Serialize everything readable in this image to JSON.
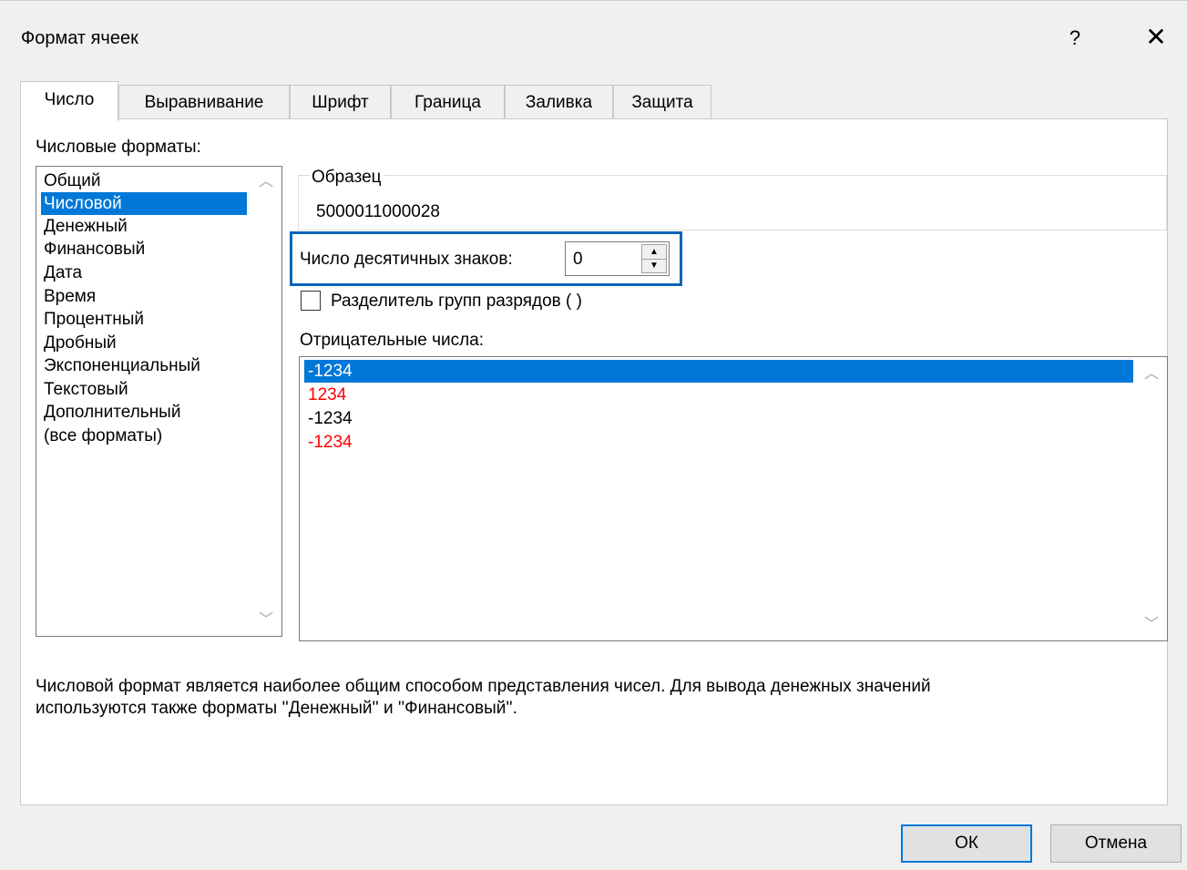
{
  "window": {
    "title": "Формат ячеек",
    "help_label": "?",
    "close_label": "✕"
  },
  "tabs": [
    {
      "label": "Число",
      "active": true
    },
    {
      "label": "Выравнивание",
      "active": false
    },
    {
      "label": "Шрифт",
      "active": false
    },
    {
      "label": "Граница",
      "active": false
    },
    {
      "label": "Заливка",
      "active": false
    },
    {
      "label": "Защита",
      "active": false
    }
  ],
  "categories": {
    "label": "Числовые форматы:",
    "items": [
      "Общий",
      "Числовой",
      "Денежный",
      "Финансовый",
      "Дата",
      "Время",
      "Процентный",
      "Дробный",
      "Экспоненциальный",
      "Текстовый",
      "Дополнительный",
      "(все форматы)"
    ],
    "selected": "Числовой"
  },
  "sample": {
    "legend": "Образец",
    "value": "5000011000028"
  },
  "decimals": {
    "label": "Число десятичных знаков:",
    "value": "0"
  },
  "separator": {
    "label": "Разделитель групп разрядов ( )",
    "checked": false
  },
  "negative_numbers": {
    "label": "Отрицательные числа:",
    "items": [
      {
        "text": "-1234",
        "color": "#000000",
        "selected": true
      },
      {
        "text": "1234",
        "color": "#ff0000",
        "selected": false
      },
      {
        "text": "-1234",
        "color": "#000000",
        "selected": false
      },
      {
        "text": "-1234",
        "color": "#ff0000",
        "selected": false
      }
    ]
  },
  "description": {
    "line1": "Числовой формат является наиболее общим способом представления чисел. Для вывода денежных значений",
    "line2": "используются также форматы ''Денежный'' и ''Финансовый''."
  },
  "buttons": {
    "ok": "ОК",
    "cancel": "Отмена"
  },
  "colors": {
    "selection": "#0078d7",
    "focus_border": "#0a64b8",
    "negative_red": "#ff0000"
  }
}
